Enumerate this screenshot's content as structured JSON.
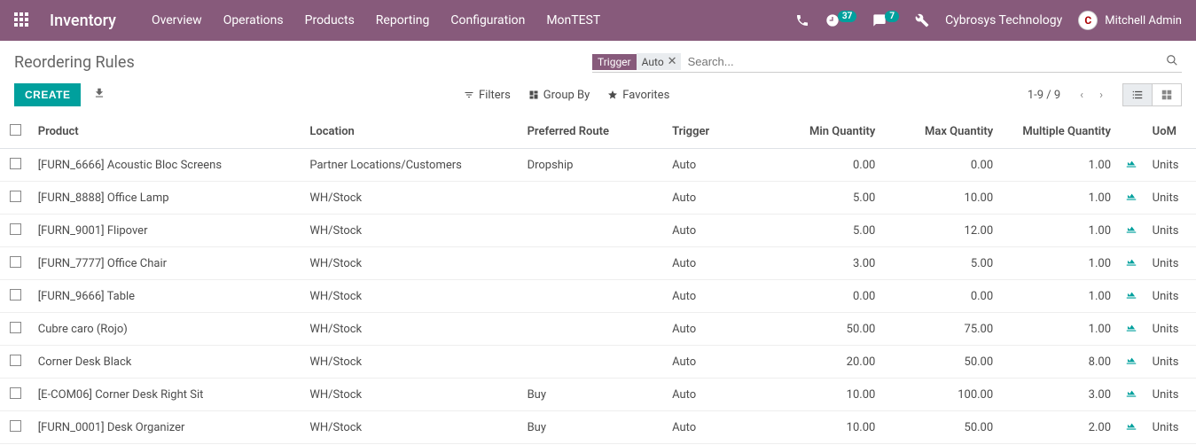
{
  "topbar": {
    "app_title": "Inventory",
    "menu": [
      "Overview",
      "Operations",
      "Products",
      "Reporting",
      "Configuration",
      "MonTEST"
    ],
    "activities_count": "37",
    "messages_count": "7",
    "company": "Cybrosys Technology",
    "user": "Mitchell Admin"
  },
  "page": {
    "title": "Reordering Rules",
    "create_label": "CREATE",
    "search_placeholder": "Search...",
    "facet_label": "Trigger",
    "facet_value": "Auto",
    "filters_label": "Filters",
    "groupby_label": "Group By",
    "favorites_label": "Favorites",
    "pager": "1-9 / 9"
  },
  "columns": {
    "product": "Product",
    "location": "Location",
    "route": "Preferred Route",
    "trigger": "Trigger",
    "min": "Min Quantity",
    "max": "Max Quantity",
    "mult": "Multiple Quantity",
    "uom": "UoM"
  },
  "rows": [
    {
      "product": "[FURN_6666] Acoustic Bloc Screens",
      "location": "Partner Locations/Customers",
      "route": "Dropship",
      "trigger": "Auto",
      "min": "0.00",
      "max": "0.00",
      "mult": "1.00",
      "uom": "Units"
    },
    {
      "product": "[FURN_8888] Office Lamp",
      "location": "WH/Stock",
      "route": "",
      "trigger": "Auto",
      "min": "5.00",
      "max": "10.00",
      "mult": "1.00",
      "uom": "Units"
    },
    {
      "product": "[FURN_9001] Flipover",
      "location": "WH/Stock",
      "route": "",
      "trigger": "Auto",
      "min": "5.00",
      "max": "12.00",
      "mult": "1.00",
      "uom": "Units"
    },
    {
      "product": "[FURN_7777] Office Chair",
      "location": "WH/Stock",
      "route": "",
      "trigger": "Auto",
      "min": "3.00",
      "max": "5.00",
      "mult": "1.00",
      "uom": "Units"
    },
    {
      "product": "[FURN_9666] Table",
      "location": "WH/Stock",
      "route": "",
      "trigger": "Auto",
      "min": "0.00",
      "max": "0.00",
      "mult": "1.00",
      "uom": "Units"
    },
    {
      "product": "Cubre caro (Rojo)",
      "location": "WH/Stock",
      "route": "",
      "trigger": "Auto",
      "min": "50.00",
      "max": "75.00",
      "mult": "1.00",
      "uom": "Units"
    },
    {
      "product": "Corner Desk Black",
      "location": "WH/Stock",
      "route": "",
      "trigger": "Auto",
      "min": "20.00",
      "max": "50.00",
      "mult": "8.00",
      "uom": "Units"
    },
    {
      "product": "[E-COM06] Corner Desk Right Sit",
      "location": "WH/Stock",
      "route": "Buy",
      "trigger": "Auto",
      "min": "10.00",
      "max": "100.00",
      "mult": "3.00",
      "uom": "Units"
    },
    {
      "product": "[FURN_0001] Desk Organizer",
      "location": "WH/Stock",
      "route": "Buy",
      "trigger": "Auto",
      "min": "10.00",
      "max": "50.00",
      "mult": "2.00",
      "uom": "Units"
    }
  ]
}
